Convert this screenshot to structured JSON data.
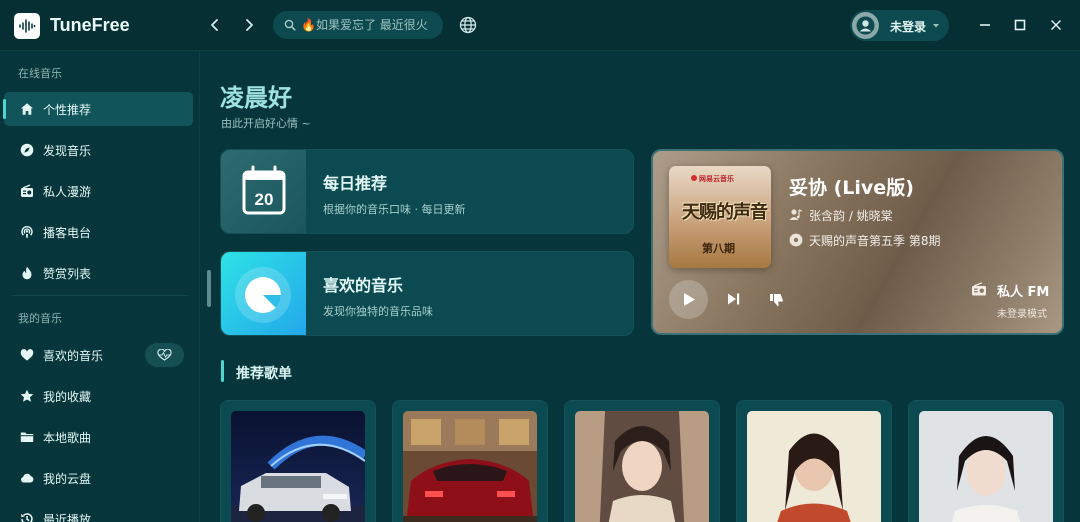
{
  "app": {
    "name": "TuneFree"
  },
  "search": {
    "placeholder": "🔥如果爱忘了 最近很火"
  },
  "user": {
    "label": "未登录"
  },
  "sidebar": {
    "online_title": "在线音乐",
    "online_items": [
      {
        "label": "个性推荐",
        "icon": "home-icon",
        "active": true
      },
      {
        "label": "发现音乐",
        "icon": "compass-icon"
      },
      {
        "label": "私人漫游",
        "icon": "radio-icon"
      },
      {
        "label": "播客电台",
        "icon": "podcast-icon"
      },
      {
        "label": "赞赏列表",
        "icon": "flame-icon"
      }
    ],
    "mine_title": "我的音乐",
    "mine_items": [
      {
        "label": "喜欢的音乐",
        "icon": "heart-icon"
      },
      {
        "label": "我的收藏",
        "icon": "star-icon"
      },
      {
        "label": "本地歌曲",
        "icon": "folder-icon"
      },
      {
        "label": "我的云盘",
        "icon": "cloud-icon"
      },
      {
        "label": "最近播放",
        "icon": "history-icon"
      }
    ]
  },
  "main": {
    "greeting": "凌晨好",
    "greeting_sub": "由此开启好心情 ~",
    "daily": {
      "title": "每日推荐",
      "subtitle": "根据你的音乐口味 · 每日更新",
      "day": "20"
    },
    "liked": {
      "title": "喜欢的音乐",
      "subtitle": "发现你独特的音乐品味"
    },
    "fm": {
      "song": "妥协 (Live版)",
      "artists": "张含韵 / 姚晓棠",
      "album": "天赐的声音第五季 第8期",
      "label": "私人 FM",
      "mode": "未登录模式",
      "cover_brand": "网易云音乐",
      "cover_title": "天赐的声音",
      "cover_episode": "第八期"
    },
    "playlists_title": "推荐歌单"
  },
  "colors": {
    "background": "#06363b",
    "accent": "#4fd6d0",
    "card": "#0b4a50"
  }
}
